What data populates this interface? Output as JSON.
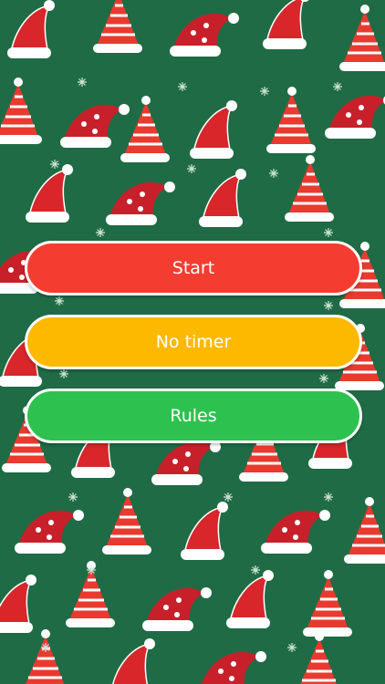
{
  "background": {
    "pattern": "santa-hats-pattern",
    "base_color": "#1f6b45",
    "hat_colors": [
      "#d8262b",
      "#e83a2f",
      "#ffffff"
    ]
  },
  "menu": {
    "start_label": "Start",
    "no_timer_label": "No timer",
    "rules_label": "Rules",
    "start_color": "#f53c30",
    "no_timer_color": "#fdb900",
    "rules_color": "#2dc24f"
  }
}
